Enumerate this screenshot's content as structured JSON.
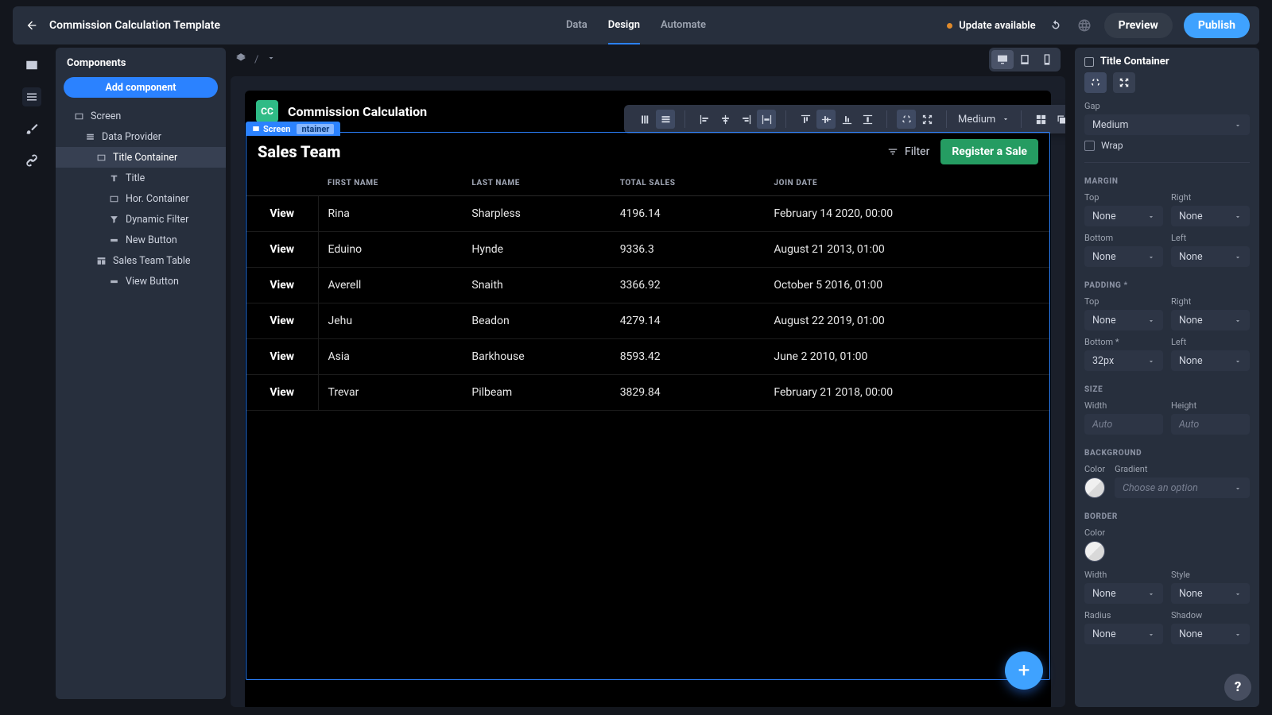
{
  "top": {
    "title": "Commission Calculation Template",
    "tabs": [
      "Data",
      "Design",
      "Automate"
    ],
    "active_tab": 1,
    "update": "Update available",
    "preview": "Preview",
    "publish": "Publish"
  },
  "components": {
    "header": "Components",
    "add": "Add component",
    "tree": [
      {
        "label": "Screen",
        "icon": "rect",
        "indent": 1
      },
      {
        "label": "Data Provider",
        "icon": "stack",
        "indent": 2
      },
      {
        "label": "Title Container",
        "icon": "rect",
        "indent": 3,
        "selected": true
      },
      {
        "label": "Title",
        "icon": "text",
        "indent": 4
      },
      {
        "label": "Hor. Container",
        "icon": "rect",
        "indent": 4
      },
      {
        "label": "Dynamic Filter",
        "icon": "funnel",
        "indent": 4
      },
      {
        "label": "New Button",
        "icon": "btn",
        "indent": 4
      },
      {
        "label": "Sales Team Table",
        "icon": "table",
        "indent": 3
      },
      {
        "label": "View Button",
        "icon": "btn",
        "indent": 4
      }
    ]
  },
  "breadcrumb": {
    "root_icon": "layers",
    "sep": "/"
  },
  "app": {
    "logo": "CC",
    "title": "Commission Calculation",
    "tag_main": "Screen",
    "tag_sub": "ntainer",
    "section_title": "Sales Team",
    "filter": "Filter",
    "register": "Register a Sale",
    "view": "View",
    "columns": [
      "FIRST NAME",
      "LAST NAME",
      "TOTAL SALES",
      "JOIN DATE"
    ],
    "rows": [
      {
        "first": "Rina",
        "last": "Sharpless",
        "total": "4196.14",
        "join": "February 14 2020, 00:00"
      },
      {
        "first": "Eduino",
        "last": "Hynde",
        "total": "9336.3",
        "join": "August 21 2013, 01:00"
      },
      {
        "first": "Averell",
        "last": "Snaith",
        "total": "3366.92",
        "join": "October 5 2016, 01:00"
      },
      {
        "first": "Jehu",
        "last": "Beadon",
        "total": "4279.14",
        "join": "August 22 2019, 01:00"
      },
      {
        "first": "Asia",
        "last": "Barkhouse",
        "total": "8593.42",
        "join": "June 2 2010, 01:00"
      },
      {
        "first": "Trevar",
        "last": "Pilbeam",
        "total": "3829.84",
        "join": "February 21 2018, 00:00"
      }
    ]
  },
  "float_toolbar": {
    "size": "Medium"
  },
  "props": {
    "title": "Title Container",
    "gap_label": "Gap",
    "gap_value": "Medium",
    "wrap": "Wrap",
    "margin": "MARGIN",
    "padding": "PADDING *",
    "size": "SIZE",
    "background": "BACKGROUND",
    "border": "BORDER",
    "top": "Top",
    "right": "Right",
    "bottom": "Bottom",
    "left": "Left",
    "bottom_star": "Bottom *",
    "none": "None",
    "px32": "32px",
    "width": "Width",
    "height": "Height",
    "auto": "Auto",
    "color": "Color",
    "gradient": "Gradient",
    "choose": "Choose an option",
    "style": "Style",
    "radius": "Radius",
    "shadow": "Shadow"
  },
  "help": "?"
}
